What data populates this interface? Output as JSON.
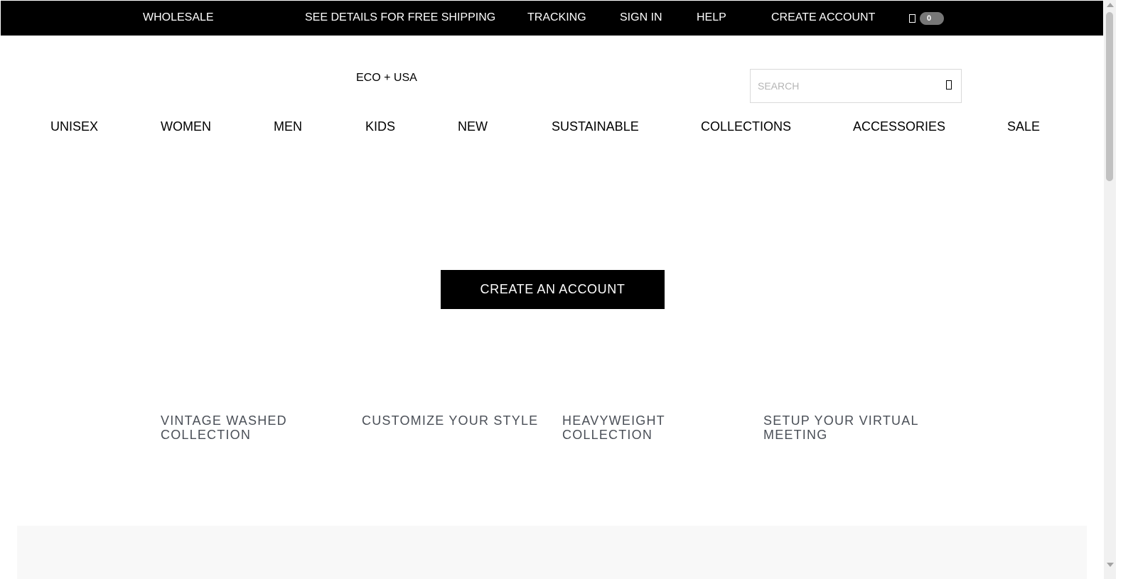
{
  "topbar": {
    "wholesale": "WHOLESALE",
    "shipping": "SEE DETAILS FOR FREE SHIPPING",
    "tracking": "TRACKING",
    "sign_in": "SIGN IN",
    "help": "HELP",
    "create_account": "CREATE ACCOUNT",
    "cart_icon": "bag-icon",
    "cart_count": "0"
  },
  "header": {
    "logo": "ECO + USA",
    "search_placeholder": "SEARCH",
    "search_value": "",
    "search_icon": "search-icon"
  },
  "nav": {
    "items": [
      "UNISEX",
      "WOMEN",
      "MEN",
      "KIDS",
      "NEW",
      "SUSTAINABLE",
      "COLLECTIONS",
      "ACCESSORIES",
      "SALE"
    ]
  },
  "hero": {
    "cta_label": "CREATE AN ACCOUNT"
  },
  "tiles": [
    {
      "line1": "VINTAGE WASHED",
      "line2": "COLLECTION"
    },
    {
      "line1": "CUSTOMIZE YOUR STYLE",
      "line2": ""
    },
    {
      "line1": "HEAVYWEIGHT",
      "line2": "COLLECTION"
    },
    {
      "line1": "SETUP YOUR VIRTUAL",
      "line2": "MEETING"
    }
  ],
  "colors": {
    "topbar_bg": "#000000",
    "cta_bg": "#000000",
    "tile_text": "#4a4f57",
    "footer_strip": "#f8f8f8"
  }
}
